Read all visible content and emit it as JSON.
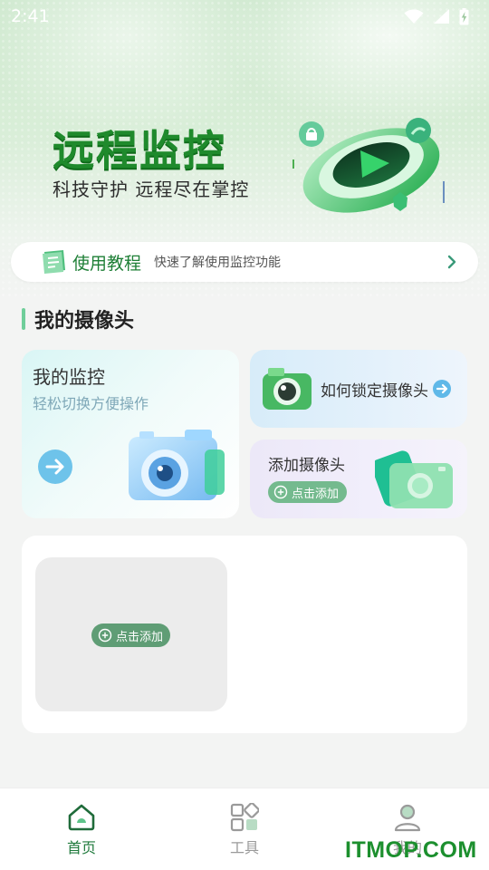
{
  "status_bar": {
    "time": "2:41",
    "icons": [
      "wifi-icon",
      "signal-icon",
      "battery-icon"
    ]
  },
  "hero": {
    "title": "远程监控",
    "subtitle": "科技守护 远程尽在掌控"
  },
  "tutorial": {
    "label": "使用教程",
    "description": "快速了解使用监控功能"
  },
  "section": {
    "title": "我的摄像头"
  },
  "cards": {
    "monitor": {
      "title": "我的监控",
      "subtitle": "轻松切换方便操作"
    },
    "lock": {
      "label": "如何锁定摄像头"
    },
    "add": {
      "label": "添加摄像头",
      "button": "点击添加"
    }
  },
  "camera_panel": {
    "slot_button": "点击添加"
  },
  "bottom_nav": {
    "items": [
      {
        "label": "首页",
        "icon": "home-icon",
        "active": true
      },
      {
        "label": "工具",
        "icon": "tools-icon",
        "active": false
      },
      {
        "label": "我的",
        "icon": "profile-icon",
        "active": false
      }
    ]
  },
  "watermark": "ITMOP.COM",
  "colors": {
    "brand_green": "#1f8a2c",
    "accent_green": "#74ba8e",
    "nav_active": "#1f7a3c",
    "nav_inactive": "#9a9a9a"
  }
}
